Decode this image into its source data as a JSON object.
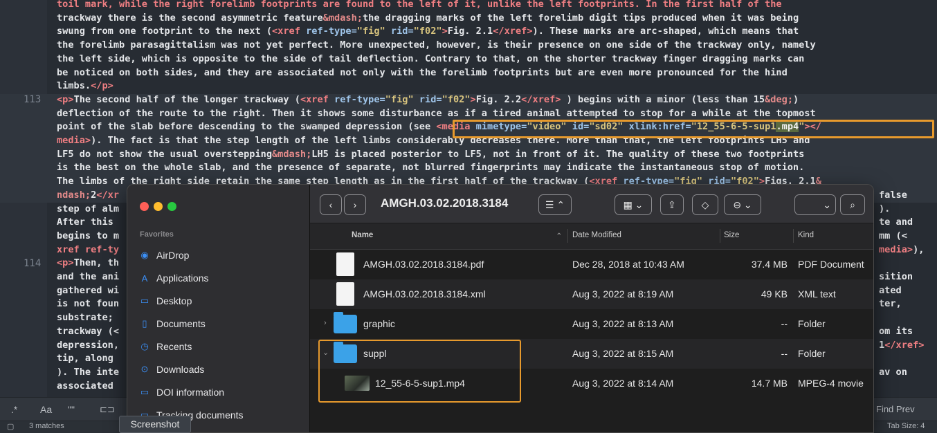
{
  "editor": {
    "line_numbers": [
      "113",
      "114"
    ],
    "lines": [
      {
        "parts": [
          [
            "t",
            "toil mark, while the right forelimb footprints are found to the left of it, unlike the left footprints. In the first half of the"
          ]
        ]
      },
      {
        "parts": [
          [
            "",
            "trackway there is the second asymmetric feature"
          ],
          [
            "e",
            "&mdash;"
          ],
          [
            "",
            "the dragging marks of the left forelimb digit tips produced when it was being"
          ]
        ]
      },
      {
        "parts": [
          [
            "",
            "swung from one footprint to the next ("
          ],
          [
            "t",
            "<xref "
          ],
          [
            "a",
            "ref-type="
          ],
          [
            "s",
            "\"fig\" "
          ],
          [
            "a",
            "rid="
          ],
          [
            "s",
            "\"f02\""
          ],
          [
            "t",
            ">"
          ],
          [
            "",
            "Fig. 2.1"
          ],
          [
            "t",
            "</xref>"
          ],
          [
            "",
            "). These marks are arc-shaped, which means that"
          ]
        ]
      },
      {
        "parts": [
          [
            "",
            "the forelimb parasagittalism was not yet perfect. More unexpected, however, is their presence on one side of the trackway only, namely"
          ]
        ]
      },
      {
        "parts": [
          [
            "",
            "the left side, which is opposite to the side of tail deflection. Contrary to that, on the shorter trackway finger dragging marks can"
          ]
        ]
      },
      {
        "parts": [
          [
            "",
            "be noticed on both sides, and they are associated not only with the forelimb footprints but are even more pronounced for the hind"
          ]
        ]
      },
      {
        "parts": [
          [
            "",
            "limbs."
          ],
          [
            "t",
            "</p>"
          ]
        ]
      },
      {
        "parts": [
          [
            "t",
            "<p>"
          ],
          [
            "",
            "The second half of the longer trackway ("
          ],
          [
            "t",
            "<xref "
          ],
          [
            "a",
            "ref-type="
          ],
          [
            "s",
            "\"fig\" "
          ],
          [
            "a",
            "rid="
          ],
          [
            "s",
            "\"f02\""
          ],
          [
            "t",
            ">"
          ],
          [
            "",
            "Fig. 2.2"
          ],
          [
            "t",
            "</xref>"
          ],
          [
            "",
            " ) begins with a minor (less than 15"
          ],
          [
            "e",
            "&deg;"
          ],
          [
            "",
            ")"
          ]
        ]
      },
      {
        "parts": [
          [
            "",
            "deflection of the route to the right. Then it shows some disturbance as if a tired animal attempted to stop for a while at the topmost"
          ]
        ]
      },
      {
        "parts": [
          [
            "",
            "point of the slab before descending to the swamped depression (see "
          ],
          [
            "t",
            "<media "
          ],
          [
            "a",
            "mimetype="
          ],
          [
            "s",
            "\"video\" "
          ],
          [
            "a",
            "id="
          ],
          [
            "s",
            "\"sd02\" "
          ],
          [
            "a",
            "xlink:href="
          ],
          [
            "s",
            "\"12_55-6-5-sup1"
          ],
          [
            "hlw",
            ".mp4"
          ],
          [
            "s",
            "\""
          ],
          [
            "t",
            "></"
          ]
        ]
      },
      {
        "parts": [
          [
            "t",
            "media>"
          ],
          [
            "",
            "). The fact is that the step length of the left limbs considerably decreases there. More than that, the left footprints LH5 and"
          ]
        ]
      },
      {
        "parts": [
          [
            "",
            "LF5 do not show the usual overstepping"
          ],
          [
            "e",
            "&mdash;"
          ],
          [
            "",
            "LH5 is placed posterior to LF5, not in front of it. The quality of these two footprints"
          ]
        ]
      },
      {
        "parts": [
          [
            "",
            "is the best on the whole slab, and the presence of separate, not blurred fingerprints may indicate the instantaneous stop of motion."
          ]
        ]
      },
      {
        "parts": [
          [
            "",
            "The limbs of the right side retain the same step length as in the first half of the trackway ("
          ],
          [
            "t",
            "<xref "
          ],
          [
            "a",
            "ref-type="
          ],
          [
            "s",
            "\"fig\" "
          ],
          [
            "a",
            "rid="
          ],
          [
            "s",
            "\"f02\""
          ],
          [
            "t",
            ">"
          ],
          [
            "",
            "Figs. 2.1"
          ],
          [
            "e",
            "&"
          ]
        ]
      },
      {
        "parts": [
          [
            "e",
            "ndash;"
          ],
          [
            "",
            "2"
          ],
          [
            "t",
            "</xr"
          ]
        ]
      },
      {
        "parts": [
          [
            "",
            "step of alm"
          ]
        ]
      },
      {
        "parts": [
          [
            "",
            "After this "
          ]
        ]
      },
      {
        "parts": [
          [
            "",
            "begins to m"
          ]
        ]
      },
      {
        "parts": [
          [
            "t",
            "xref ref-ty"
          ]
        ]
      },
      {
        "parts": [
          [
            "t",
            "<p>"
          ],
          [
            "",
            "Then, th"
          ]
        ]
      },
      {
        "parts": [
          [
            "",
            "and the ani"
          ]
        ]
      },
      {
        "parts": [
          [
            "",
            "gathered wi"
          ]
        ]
      },
      {
        "parts": [
          [
            "",
            "is not foun"
          ]
        ]
      },
      {
        "parts": [
          [
            "",
            "substrate; "
          ]
        ]
      },
      {
        "parts": [
          [
            "",
            "trackway (<"
          ]
        ]
      },
      {
        "parts": [
          [
            "",
            "depression,"
          ]
        ]
      },
      {
        "parts": [
          [
            "",
            "tip, along "
          ]
        ]
      },
      {
        "parts": [
          [
            "",
            "). The inte"
          ]
        ]
      },
      {
        "parts": [
          [
            "",
            "associated "
          ]
        ]
      }
    ],
    "right_fragments": [
      {
        "row": 14,
        "parts": [
          [
            "",
            "false"
          ]
        ]
      },
      {
        "row": 15,
        "parts": [
          [
            "",
            ")."
          ]
        ]
      },
      {
        "row": 16,
        "parts": [
          [
            "",
            "te and"
          ]
        ]
      },
      {
        "row": 17,
        "parts": [
          [
            "",
            "mm (<"
          ]
        ]
      },
      {
        "row": 18,
        "parts": [
          [
            "t",
            "media>"
          ],
          [
            "",
            "),"
          ]
        ]
      },
      {
        "row": 20,
        "parts": [
          [
            "",
            "sition"
          ]
        ]
      },
      {
        "row": 21,
        "parts": [
          [
            "",
            "ated"
          ]
        ]
      },
      {
        "row": 22,
        "parts": [
          [
            "",
            "ter,"
          ]
        ]
      },
      {
        "row": 24,
        "parts": [
          [
            "",
            "om its"
          ]
        ]
      },
      {
        "row": 25,
        "parts": [
          [
            "",
            "1"
          ],
          [
            "t",
            "</xref>"
          ]
        ]
      },
      {
        "row": 27,
        "parts": [
          [
            "",
            "av on"
          ]
        ]
      }
    ]
  },
  "findbar": {
    "regex_icon": ".*",
    "case_label": "Aa",
    "word_label": "\"\"",
    "find_prev": "Find Prev",
    "matches": "3 matches",
    "tab_size": "Tab Size: 4"
  },
  "tooltip": "Screenshot",
  "finder": {
    "title": "AMGH.03.02.2018.3184",
    "favorites_label": "Favorites",
    "sidebar": [
      {
        "label": "AirDrop",
        "icon": "airdrop-icon",
        "glyph": "◉"
      },
      {
        "label": "Applications",
        "icon": "applications-icon",
        "glyph": "A"
      },
      {
        "label": "Desktop",
        "icon": "desktop-icon",
        "glyph": "▭"
      },
      {
        "label": "Documents",
        "icon": "documents-icon",
        "glyph": "▯"
      },
      {
        "label": "Recents",
        "icon": "recents-icon",
        "glyph": "◷"
      },
      {
        "label": "Downloads",
        "icon": "downloads-icon",
        "glyph": "⊙"
      },
      {
        "label": "DOI information",
        "icon": "folder-icon",
        "glyph": "▭"
      },
      {
        "label": "Tracking documents",
        "icon": "folder-icon",
        "glyph": "▭"
      }
    ],
    "columns": {
      "name": "Name",
      "date": "Date Modified",
      "size": "Size",
      "kind": "Kind"
    },
    "rows": [
      {
        "name": "AMGH.03.02.2018.3184.pdf",
        "date": "Dec 28, 2018 at 10:43 AM",
        "size": "37.4 MB",
        "kind": "PDF Document",
        "type": "pdf"
      },
      {
        "name": "AMGH.03.02.2018.3184.xml",
        "date": "Aug 3, 2022 at 8:19 AM",
        "size": "49 KB",
        "kind": "XML text",
        "type": "xml"
      },
      {
        "name": "graphic",
        "date": "Aug 3, 2022 at 8:13 AM",
        "size": "--",
        "kind": "Folder",
        "type": "folder"
      },
      {
        "name": "suppl",
        "date": "Aug 3, 2022 at 8:15 AM",
        "size": "--",
        "kind": "Folder",
        "type": "folder"
      },
      {
        "name": "12_55-6-5-sup1.mp4",
        "date": "Aug 3, 2022 at 8:14 AM",
        "size": "14.7 MB",
        "kind": "MPEG-4 movie",
        "type": "video"
      }
    ]
  }
}
